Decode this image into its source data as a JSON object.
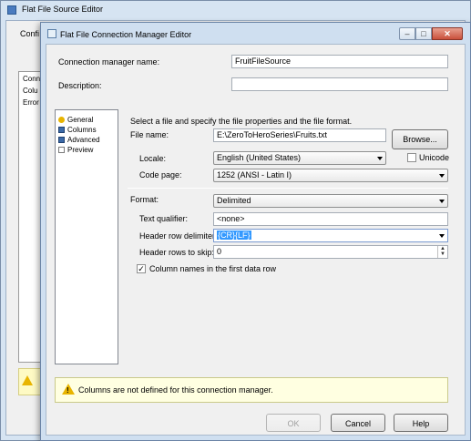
{
  "outer_window": {
    "title": "Flat File Source Editor",
    "conf_label": "Confi",
    "list_items": [
      "Conn",
      "Colu",
      "Error"
    ]
  },
  "dialog": {
    "title": "Flat File Connection Manager Editor",
    "connection_manager_name_label": "Connection manager name:",
    "connection_manager_name_value": "FruitFileSource",
    "description_label": "Description:",
    "description_value": "",
    "nav_items": [
      {
        "label": "General",
        "icon": "general-icon"
      },
      {
        "label": "Columns",
        "icon": "columns-icon"
      },
      {
        "label": "Advanced",
        "icon": "advanced-icon"
      },
      {
        "label": "Preview",
        "icon": "preview-icon"
      }
    ],
    "instruction": "Select a file and specify the file properties and the file format.",
    "file_name_label": "File name:",
    "file_name_value": "E:\\ZeroToHeroSeries\\Fruits.txt",
    "browse_label": "Browse...",
    "locale_label": "Locale:",
    "locale_value": "English (United States)",
    "unicode_label": "Unicode",
    "code_page_label": "Code page:",
    "code_page_value": "1252  (ANSI - Latin I)",
    "format_label": "Format:",
    "format_value": "Delimited",
    "text_qualifier_label": "Text qualifier:",
    "text_qualifier_value": "<none>",
    "header_row_delimiter_label": "Header row delimiter:",
    "header_row_delimiter_value": "{CR}{LF}",
    "header_rows_to_skip_label": "Header rows to skip:",
    "header_rows_to_skip_value": "0",
    "column_names_label": "Column names in the first data row",
    "column_names_checked": true,
    "unicode_checked": false,
    "warning_text": "Columns are not defined for this connection manager.",
    "ok_label": "OK",
    "cancel_label": "Cancel",
    "help_label": "Help"
  },
  "colors": {
    "titlebar": "#cfdff0",
    "warning_bg": "#ffffe1",
    "selection": "#3399ff"
  }
}
